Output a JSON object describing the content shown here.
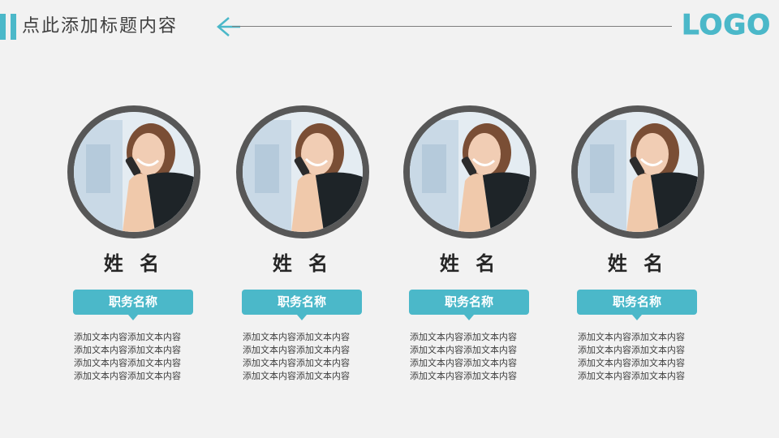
{
  "header": {
    "title": "点此添加标题内容",
    "logo": "LOGO",
    "accent_color": "#4bb8c9",
    "arrow_icon": "arrow-left-icon"
  },
  "team": [
    {
      "name": "姓 名",
      "role": "职务名称",
      "photo_icon": "woman-on-phone-photo",
      "lines": [
        "添加文本内容添加文本内容",
        "添加文本内容添加文本内容",
        "添加文本内容添加文本内容",
        "添加文本内容添加文本内容"
      ]
    },
    {
      "name": "姓 名",
      "role": "职务名称",
      "photo_icon": "woman-on-phone-photo",
      "lines": [
        "添加文本内容添加文本内容",
        "添加文本内容添加文本内容",
        "添加文本内容添加文本内容",
        "添加文本内容添加文本内容"
      ]
    },
    {
      "name": "姓 名",
      "role": "职务名称",
      "photo_icon": "woman-on-phone-photo",
      "lines": [
        "添加文本内容添加文本内容",
        "添加文本内容添加文本内容",
        "添加文本内容添加文本内容",
        "添加文本内容添加文本内容"
      ]
    },
    {
      "name": "姓 名",
      "role": "职务名称",
      "photo_icon": "woman-on-phone-photo",
      "lines": [
        "添加文本内容添加文本内容",
        "添加文本内容添加文本内容",
        "添加文本内容添加文本内容",
        "添加文本内容添加文本内容"
      ]
    }
  ]
}
